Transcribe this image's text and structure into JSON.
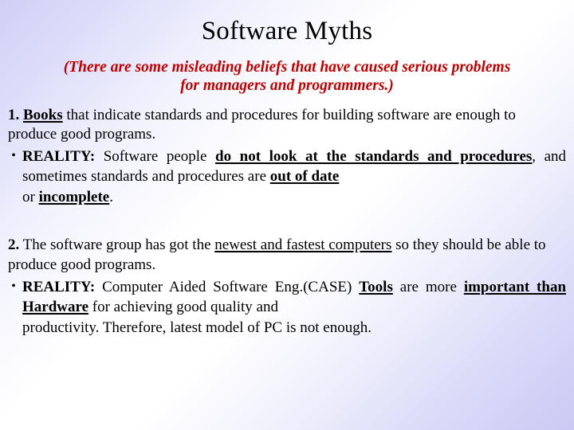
{
  "slide": {
    "title": "Software Myths",
    "subtitle_line1": "(There are some misleading beliefs that have caused serious problems",
    "subtitle_line2": "for managers and programmers.)",
    "subtitle_color": "#c00000",
    "title_color": "#000000",
    "background_accent": "#cfcff5"
  },
  "myths": [
    {
      "number": "1.",
      "statement_before": " ",
      "statement_keyword": "Books",
      "statement_after": " that indicate standards and procedures for building software are enough to produce good programs.",
      "reality_bullet": "•",
      "reality_label": "REALITY:",
      "reality_p1": " Software people ",
      "reality_u1": "do not look at the standards and procedures",
      "reality_p2": ", and sometimes standards and procedures are ",
      "reality_u2": "out of date",
      "reality_p3": " or ",
      "reality_u3": "incomplete",
      "reality_p4": "."
    },
    {
      "number": "2.",
      "statement_before": " The software group has got the ",
      "statement_keyword": "newest and fastest computers",
      "statement_after": " so they should be able to produce good programs.",
      "reality_bullet": "•",
      "reality_label": "REALITY:",
      "reality_p1": " Computer Aided Software Eng.(CASE) ",
      "reality_u1": "Tools",
      "reality_p2": " are more ",
      "reality_u2": "important than Hardware",
      "reality_p3": " for achieving good quality and ",
      "reality_p4": "productivity. Therefore, latest model of PC is not enough."
    }
  ]
}
